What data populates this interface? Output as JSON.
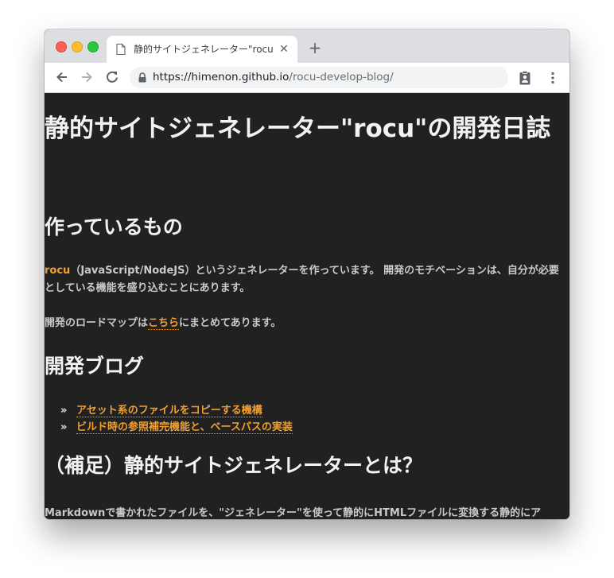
{
  "browser": {
    "tab_title": "静的サイトジェネレーター\"rocu\"の開発日誌",
    "tab_close": "✕",
    "new_tab": "+",
    "url_host": "https://himenon.github.io",
    "url_path": "/rocu-develop-blog/"
  },
  "page": {
    "title": "静的サイトジェネレーター\"rocu\"の開発日誌",
    "section1_heading": "作っているもの",
    "intro_link": "rocu",
    "intro_text": "（JavaScript/NodeJS）というジェネレーターを作っています。 開発のモチベーションは、自分が必要としている機能を盛り込むことにあります。",
    "roadmap_prefix": "開発のロードマップは",
    "roadmap_link": "こちら",
    "roadmap_suffix": "にまとめてあります。",
    "section2_heading": "開発ブログ",
    "bullet_marker": "»",
    "blog_posts": [
      "アセット系のファイルをコピーする機構",
      "ビルド時の参照補完機能と、ベースパスの実装"
    ],
    "section3_heading": "（補足）静的サイトジェネレーターとは？",
    "supplement_text": "Markdownで書かれたファイルを、\"ジェネレーター\"を使って静的にHTMLファイルに変換する静的にア"
  },
  "colors": {
    "page_background": "#212121",
    "link": "#f0a030",
    "traffic_red": "#fe5f57",
    "traffic_yellow": "#febc2e",
    "traffic_green": "#28c840"
  },
  "icons": [
    "document-icon",
    "back-arrow-icon",
    "forward-arrow-icon",
    "reload-icon",
    "lock-icon",
    "clipboard-person-icon",
    "kebab-menu-icon"
  ]
}
